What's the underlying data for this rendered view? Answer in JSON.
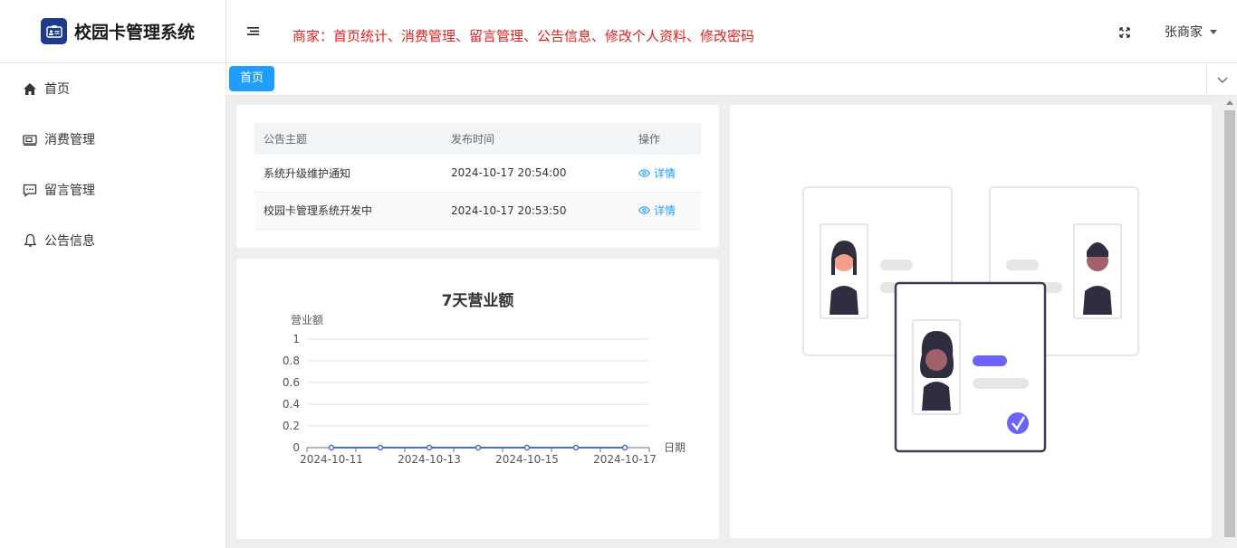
{
  "app": {
    "title": "校园卡管理系统"
  },
  "sidebar": {
    "items": [
      {
        "label": "首页",
        "icon": "home-icon"
      },
      {
        "label": "消费管理",
        "icon": "wallet-icon"
      },
      {
        "label": "留言管理",
        "icon": "message-icon"
      },
      {
        "label": "公告信息",
        "icon": "bell-icon"
      }
    ]
  },
  "header": {
    "notice": "商家：首页统计、消费管理、留言管理、公告信息、修改个人资料、修改密码",
    "user": "张商家"
  },
  "tabs": {
    "active": "首页"
  },
  "notices": {
    "columns": [
      "公告主题",
      "发布时间",
      "操作"
    ],
    "rows": [
      {
        "title": "系统升级维护通知",
        "time": "2024-10-17 20:54:00",
        "action": "详情"
      },
      {
        "title": "校园卡管理系统开发中",
        "time": "2024-10-17 20:53:50",
        "action": "详情"
      }
    ]
  },
  "colors": {
    "accent": "#1e9fff",
    "notice": "#e02020",
    "logo": "#1f3a8a",
    "line": "#4a70c0"
  },
  "chart_data": {
    "type": "line",
    "title": "7天营业额",
    "ylabel": "营业额",
    "xlabel": "日期",
    "x": [
      "2024-10-11",
      "2024-10-12",
      "2024-10-13",
      "2024-10-14",
      "2024-10-15",
      "2024-10-16",
      "2024-10-17"
    ],
    "x_tick_labels": [
      "2024-10-11",
      "2024-10-13",
      "2024-10-15",
      "2024-10-17"
    ],
    "y_ticks": [
      "0",
      "0.2",
      "0.4",
      "0.6",
      "0.8",
      "1"
    ],
    "values": [
      0,
      0,
      0,
      0,
      0,
      0,
      0
    ],
    "ylim": [
      0,
      1
    ],
    "grid": true
  }
}
